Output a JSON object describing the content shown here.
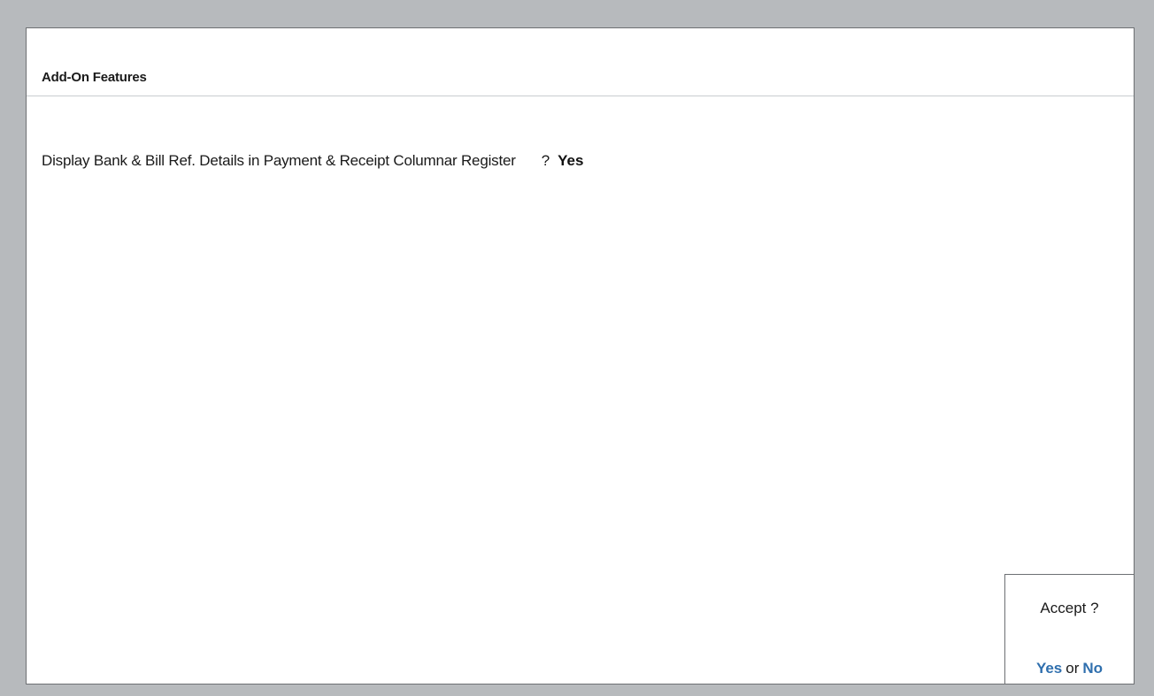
{
  "section": {
    "title": "Add-On Features"
  },
  "option": {
    "label": "Display Bank & Bill Ref. Details in Payment & Receipt Columnar Register",
    "separator": "?",
    "value": "Yes"
  },
  "accept_dialog": {
    "question": "Accept ?",
    "yes_label": "Yes",
    "or_label": "or",
    "no_label": "No"
  },
  "colors": {
    "background": "#b7babd",
    "panel": "#ffffff",
    "choice_accent": "#2f6fae"
  }
}
